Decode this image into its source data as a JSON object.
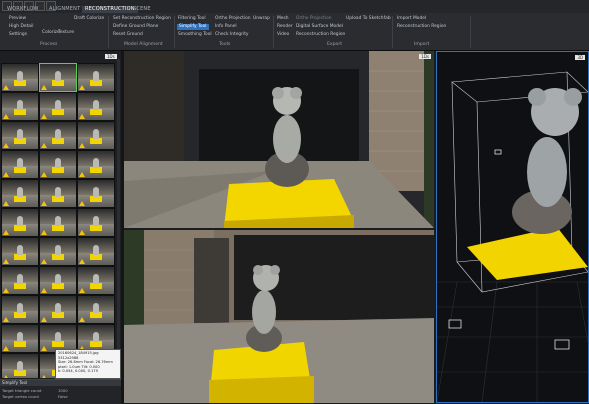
{
  "tabs": [
    "WORKFLOW",
    "ALIGNMENT",
    "RECONSTRUCTION",
    "SCENE"
  ],
  "active_tab": "RECONSTRUCTION",
  "ribbon": {
    "process": {
      "items": [
        "Preview",
        "High Detail",
        "Settings",
        "Colorize",
        "Texture",
        "Draft Colorize"
      ],
      "group_label": "Process"
    },
    "model_alignment": {
      "items": [
        "Set Reconstruction Region",
        "Define Ground Plane",
        "Reset Ground"
      ],
      "group_label": "Model Alignment"
    },
    "tools": {
      "items": [
        "Filtering Tool",
        "Simplify Tool",
        "Smoothing Tool",
        "Ortho Projection",
        "Unwrap",
        "Info Panel",
        "Check Integrity"
      ],
      "group_label": "Tools"
    },
    "export": {
      "items": [
        "Mesh",
        "Render",
        "Video",
        "Ortho Projection",
        "Digital Surface Model",
        "Reconstruction Region",
        "Upload To Sketchfab"
      ],
      "group_label": "Export"
    },
    "import": {
      "items": [
        "Import Model",
        "Reconstruction Region"
      ],
      "group_label": "Import"
    }
  },
  "thumbnails": {
    "header": "1Ds"
  },
  "tooltip": {
    "lines": [
      "20160624_184915.jpg",
      "5312x2988",
      "Size: 26.8mm Focal: 26.76mm",
      "pixel: 1.0um Tilt: 0.000",
      "k: 0.054, 0.000, 0.179"
    ]
  },
  "properties": {
    "title": "Simplify Tool",
    "rows": [
      {
        "label": "Target triangle count",
        "value": "1000"
      },
      {
        "label": "Target vertex count",
        "value": "False"
      }
    ]
  },
  "viewports": {
    "top_label": "1Ds",
    "bottom_label": "",
    "scene_label": "3D"
  }
}
